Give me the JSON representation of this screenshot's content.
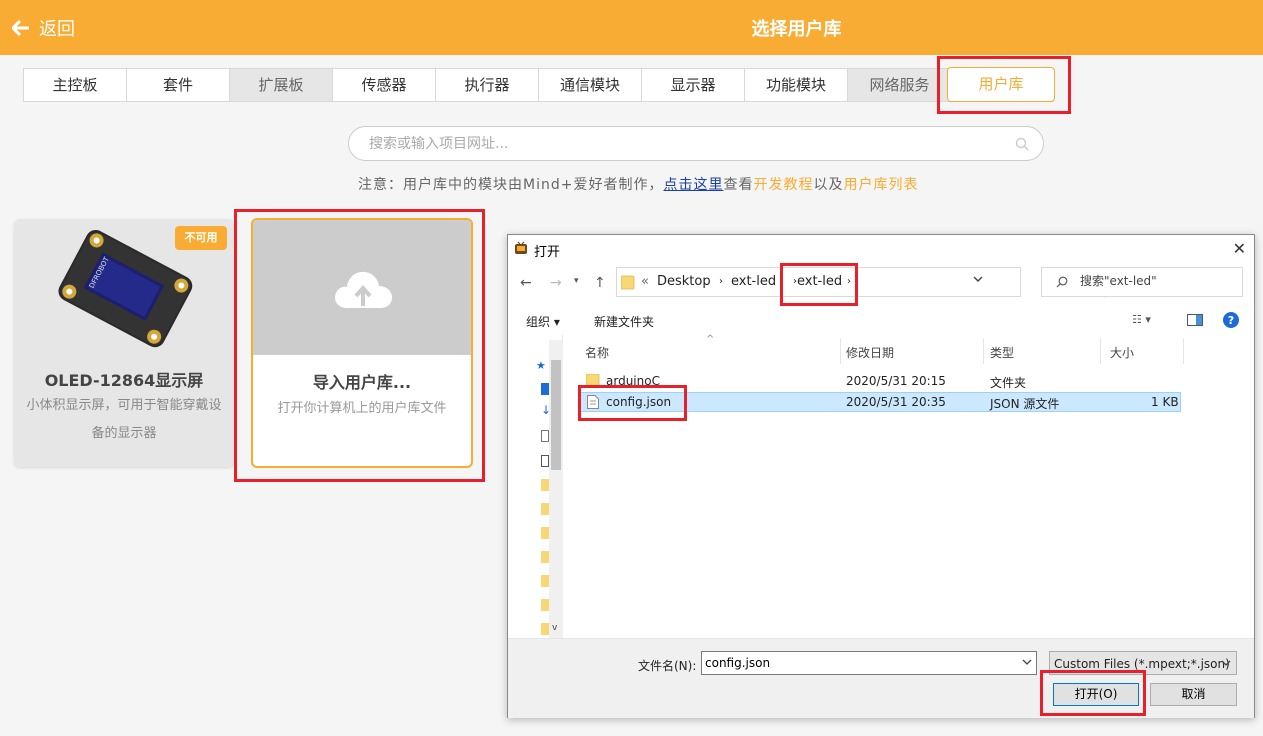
{
  "header": {
    "back_label": "返回",
    "title": "选择用户库"
  },
  "tabs": [
    {
      "label": "主控板"
    },
    {
      "label": "套件"
    },
    {
      "label": "扩展板"
    },
    {
      "label": "传感器"
    },
    {
      "label": "执行器"
    },
    {
      "label": "通信模块"
    },
    {
      "label": "显示器"
    },
    {
      "label": "功能模块"
    },
    {
      "label": "网络服务"
    }
  ],
  "active_tab": {
    "label": "用户库"
  },
  "search": {
    "placeholder": "搜索或输入项目网址..."
  },
  "notice": {
    "prefix": "注意：用户库中的模块由Mind+爱好者制作，",
    "link": "点击这里",
    "mid": "查看",
    "tutorial": "开发教程",
    "and": "以及",
    "list": "用户库列表"
  },
  "library_card": {
    "badge": "不可用",
    "title": "OLED-12864显示屏",
    "desc": "小体积显示屏，可用于智能穿戴设备的显示器",
    "brand": "DFROBOT"
  },
  "import_card": {
    "title": "导入用户库...",
    "desc": "打开你计算机上的用户库文件"
  },
  "dialog": {
    "title": "打开",
    "path": {
      "prefix": "«",
      "seg1": "Desktop",
      "seg2": "ext-led"
    },
    "search_placeholder": "搜索\"ext-led\"",
    "toolbar": {
      "organize": "组织 ▾",
      "new_folder": "新建文件夹"
    },
    "columns": {
      "name": "名称",
      "date": "修改日期",
      "type": "类型",
      "size": "大小"
    },
    "files": [
      {
        "name": "arduinoC",
        "date": "2020/5/31 20:15",
        "type": "文件夹",
        "size": ""
      },
      {
        "name": "config.json",
        "date": "2020/5/31 20:35",
        "type": "JSON 源文件",
        "size": "1 KB"
      }
    ],
    "filename_label": "文件名(N):",
    "filename_value": "config.json",
    "filter": "Custom Files (*.mpext;*.json)",
    "open_label": "打开(O)",
    "cancel_label": "取消"
  },
  "colors": {
    "accent": "#f9ac33",
    "highlight": "#e8202a",
    "selection": "#cce8ff"
  }
}
